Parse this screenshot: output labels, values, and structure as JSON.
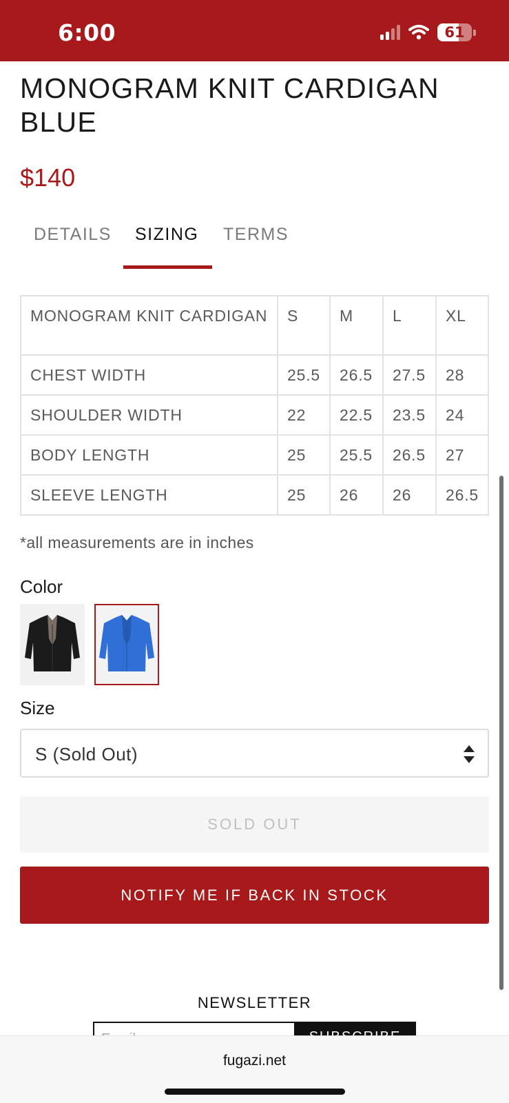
{
  "status_bar": {
    "time": "6:00",
    "battery": "61",
    "battery_level": 0.61,
    "icons": [
      "signal-icon",
      "wifi-icon",
      "battery-icon"
    ],
    "background": "#a8191b"
  },
  "product": {
    "title": "MONOGRAM KNIT CARDIGAN BLUE",
    "price": "$140",
    "accent_color": "#a8191b"
  },
  "tabs": [
    {
      "label": "DETAILS",
      "active": false
    },
    {
      "label": "SIZING",
      "active": true
    },
    {
      "label": "TERMS",
      "active": false
    }
  ],
  "sizing_table": {
    "header": [
      "MONOGRAM KNIT CARDIGAN",
      "S",
      "M",
      "L",
      "XL"
    ],
    "rows": [
      [
        "CHEST WIDTH",
        "25.5",
        "26.5",
        "27.5",
        "28"
      ],
      [
        "SHOULDER WIDTH",
        "22",
        "22.5",
        "23.5",
        "24"
      ],
      [
        "BODY LENGTH",
        "25",
        "25.5",
        "26.5",
        "27"
      ],
      [
        "SLEEVE LENGTH",
        "25",
        "26",
        "26",
        "26.5"
      ]
    ]
  },
  "note": "*all measurements are in inches",
  "color": {
    "label": "Color",
    "swatches": [
      {
        "name": "black-cardigan",
        "color": "#1c1c1c",
        "selected": false
      },
      {
        "name": "blue-cardigan",
        "color": "#2f6fd6",
        "selected": true
      }
    ]
  },
  "size": {
    "label": "Size",
    "selected": "S (Sold Out)"
  },
  "buttons": {
    "sold_out": "SOLD OUT",
    "notify": "NOTIFY ME IF BACK IN STOCK"
  },
  "newsletter": {
    "title": "NEWSLETTER",
    "email_placeholder": "Email",
    "subscribe": "SUBSCRIBE"
  },
  "browser": {
    "url": "fugazi.net"
  }
}
